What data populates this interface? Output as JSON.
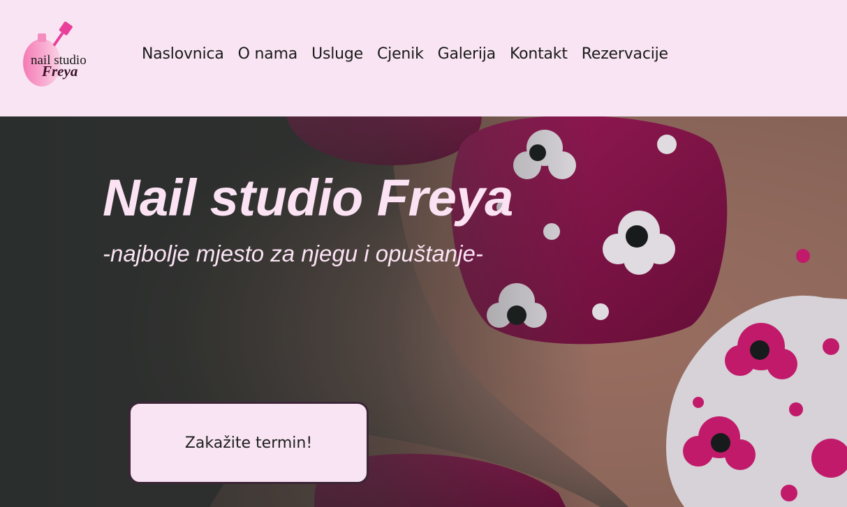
{
  "logo": {
    "line1": "nail studio",
    "line2": "Freya",
    "icon": "nail-polish-bottle-icon"
  },
  "nav": {
    "items": [
      "Naslovnica",
      "O nama",
      "Usluge",
      "Cjenik",
      "Galerija",
      "Kontakt",
      "Rezervacije"
    ]
  },
  "hero": {
    "title": "Nail studio Freya",
    "subtitle": "-najbolje mjesto za njegu i opuštanje-",
    "cta_label": "Zakažite termin!"
  },
  "colors": {
    "header_bg": "#f8e4f2",
    "accent_pink": "#e8409a",
    "nail_magenta": "#8a1248",
    "hero_text": "#fbe3f4"
  }
}
